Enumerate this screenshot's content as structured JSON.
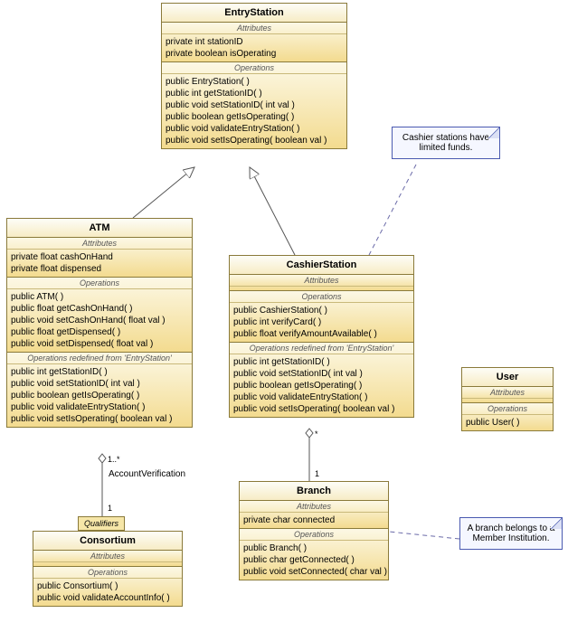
{
  "chart_data": {
    "type": "uml-class-diagram",
    "classes": [
      {
        "name": "EntryStation",
        "attributes": [
          "private int stationID",
          "private boolean isOperating"
        ],
        "operations": [
          "public EntryStation( )",
          "public int  getStationID( )",
          "public void  setStationID( int val )",
          "public boolean  getIsOperating( )",
          "public void  validateEntryStation( )",
          "public void  setIsOperating( boolean val )"
        ]
      },
      {
        "name": "ATM",
        "attributes": [
          "private float cashOnHand",
          "private float dispensed"
        ],
        "operations": [
          "public ATM( )",
          "public float  getCashOnHand( )",
          "public void  setCashOnHand( float val )",
          "public float  getDispensed( )",
          "public void  setDispensed( float val )"
        ],
        "redefined_from": "EntryStation",
        "redefined_ops": [
          "public int  getStationID( )",
          "public void  setStationID( int val )",
          "public boolean  getIsOperating( )",
          "public void  validateEntryStation( )",
          "public void  setIsOperating( boolean val )"
        ]
      },
      {
        "name": "CashierStation",
        "attributes": [],
        "operations": [
          "public CashierStation( )",
          "public int  verifyCard( )",
          "public float  verifyAmountAvailable( )"
        ],
        "redefined_from": "EntryStation",
        "redefined_ops": [
          "public int  getStationID( )",
          "public void  setStationID( int val )",
          "public boolean  getIsOperating( )",
          "public void  validateEntryStation( )",
          "public void  setIsOperating( boolean val )"
        ]
      },
      {
        "name": "Consortium",
        "attributes": [],
        "operations": [
          "public Consortium( )",
          "public void  validateAccountInfo( )"
        ]
      },
      {
        "name": "Branch",
        "attributes": [
          "private char connected"
        ],
        "operations": [
          "public Branch( )",
          "public char  getConnected( )",
          "public void  setConnected( char val )"
        ]
      },
      {
        "name": "User",
        "attributes": [],
        "operations": [
          "public User( )"
        ]
      }
    ],
    "relationships": [
      {
        "type": "generalization",
        "from": "ATM",
        "to": "EntryStation"
      },
      {
        "type": "generalization",
        "from": "CashierStation",
        "to": "EntryStation"
      },
      {
        "type": "association",
        "from": "ATM",
        "to": "Consortium",
        "name": "AccountVerification",
        "from_mult": "1..*",
        "to_mult": "1",
        "qualifier": "Qualifiers"
      },
      {
        "type": "association",
        "from": "CashierStation",
        "to": "Branch",
        "from_mult": "*",
        "to_mult": "1"
      },
      {
        "type": "note-link",
        "from": "note_cashier",
        "to": "CashierStation"
      },
      {
        "type": "note-link",
        "from": "note_branch",
        "to": "Branch"
      }
    ],
    "notes": [
      {
        "id": "note_cashier",
        "text": "Cashier stations have limited funds."
      },
      {
        "id": "note_branch",
        "text": "A branch belongs to a Member Institution."
      }
    ]
  },
  "labels": {
    "attributes": "Attributes",
    "operations": "Operations",
    "redef_prefix": "Operations redefined from '",
    "redef_suffix": "'",
    "assoc_account_verification": "AccountVerification",
    "qualifier": "Qualifiers",
    "mult_1": "1",
    "mult_1star": "1..*",
    "mult_star": "*"
  }
}
